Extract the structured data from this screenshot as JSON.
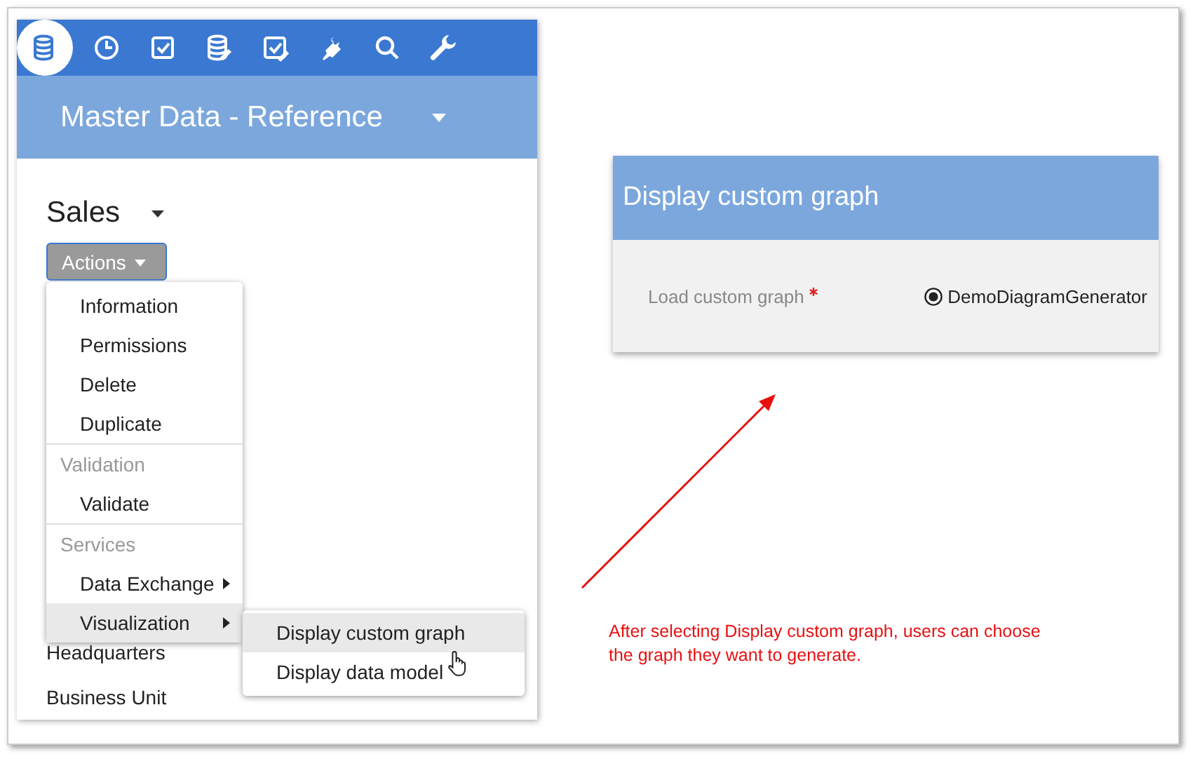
{
  "toolbar": [
    {
      "kind": "database",
      "selected": true
    },
    {
      "kind": "clock",
      "selected": false
    },
    {
      "kind": "checkbox",
      "selected": false
    },
    {
      "kind": "database-edit",
      "selected": false
    },
    {
      "kind": "checkbox-edit",
      "selected": false
    },
    {
      "kind": "plug",
      "selected": false
    },
    {
      "kind": "search",
      "selected": false
    },
    {
      "kind": "wrench",
      "selected": false
    }
  ],
  "header": {
    "title": "Master Data - Reference"
  },
  "section": {
    "title": "Sales"
  },
  "actions_button": {
    "label": "Actions"
  },
  "actions_menu": [
    {
      "items": [
        {
          "label": "Information",
          "submenu": false,
          "selected": false
        },
        {
          "label": "Permissions",
          "submenu": false,
          "selected": false
        },
        {
          "label": "Delete",
          "submenu": false,
          "selected": false
        },
        {
          "label": "Duplicate",
          "submenu": false,
          "selected": false
        }
      ]
    },
    {
      "header": "Validation",
      "items": [
        {
          "label": "Validate",
          "submenu": false,
          "selected": false
        }
      ]
    },
    {
      "header": "Services",
      "items": [
        {
          "label": "Data Exchange",
          "submenu": true,
          "selected": false
        },
        {
          "label": "Visualization",
          "submenu": true,
          "selected": true
        }
      ]
    }
  ],
  "submenu": [
    {
      "label": "Display custom graph",
      "selected": true
    },
    {
      "label": "Display data model",
      "selected": false
    }
  ],
  "list": [
    "Headquarters",
    "Business Unit"
  ],
  "dialog": {
    "title": "Display custom graph",
    "field_label": "Load custom graph",
    "required": true,
    "option": {
      "label": "DemoDiagramGenerator",
      "selected": true
    }
  },
  "note": "After selecting Display custom graph, users can choose the graph they want to generate."
}
